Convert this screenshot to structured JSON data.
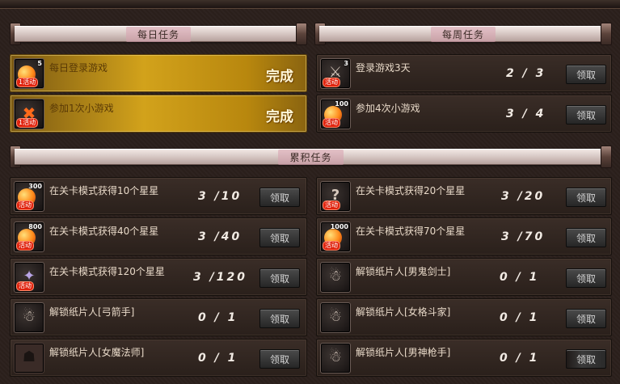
{
  "sections": {
    "daily": {
      "title": "每日任务"
    },
    "weekly": {
      "title": "每周任务"
    },
    "cumulative": {
      "title": "累积任务"
    }
  },
  "daily_tasks": [
    {
      "label": "每日登录游戏",
      "icon_num": "5",
      "icon_tag": "1活动",
      "status": "完成",
      "icon": "gift-orb-icon"
    },
    {
      "label": "参加1次小游戏",
      "icon_num": "",
      "icon_tag": "1活动",
      "status": "完成",
      "icon": "gift-cross-icon"
    }
  ],
  "weekly_tasks": [
    {
      "label": "登录游戏3天",
      "icon_num": "3",
      "icon_tag": "活动",
      "progress": "2 / 3",
      "button": "领取",
      "icon": "sword-icon"
    },
    {
      "label": "参加4次小游戏",
      "icon_num": "100",
      "icon_tag": "活动",
      "progress": "3 / 4",
      "button": "领取",
      "icon": "gift-orb-icon"
    }
  ],
  "cumulative_tasks": [
    {
      "label": "在关卡模式获得10个星星",
      "icon_num": "300",
      "icon_tag": "活动",
      "progress": "3 /10",
      "button": "领取",
      "icon": "gift-orb-icon"
    },
    {
      "label": "在关卡模式获得20个星星",
      "icon_num": "",
      "icon_tag": "活动",
      "progress": "3 /20",
      "button": "领取",
      "icon": "question-icon"
    },
    {
      "label": "在关卡模式获得40个星星",
      "icon_num": "800",
      "icon_tag": "活动",
      "progress": "3 /40",
      "button": "领取",
      "icon": "gift-orb-icon"
    },
    {
      "label": "在关卡模式获得70个星星",
      "icon_num": "1000",
      "icon_tag": "活动",
      "progress": "3 /70",
      "button": "领取",
      "icon": "gift-orb-icon"
    },
    {
      "label": "在关卡模式获得120个星星",
      "icon_num": "",
      "icon_tag": "活动",
      "progress": "3 /120",
      "button": "领取",
      "icon": "character-icon"
    },
    {
      "label": "解锁纸片人[男鬼剑士]",
      "icon_num": "",
      "icon_tag": "",
      "progress": "0 / 1",
      "button": "领取",
      "icon": "paper-figure-icon"
    },
    {
      "label": "解锁纸片人[弓箭手]",
      "icon_num": "",
      "icon_tag": "",
      "progress": "0 / 1",
      "button": "领取",
      "icon": "paper-figure-icon"
    },
    {
      "label": "解锁纸片人[女格斗家]",
      "icon_num": "",
      "icon_tag": "",
      "progress": "0 / 1",
      "button": "领取",
      "icon": "paper-figure-icon"
    },
    {
      "label": "解锁纸片人[女魔法师]",
      "icon_num": "",
      "icon_tag": "",
      "progress": "0 / 1",
      "button": "领取",
      "icon": "paper-figure-icon"
    },
    {
      "label": "解锁纸片人[男神枪手]",
      "icon_num": "",
      "icon_tag": "",
      "progress": "0 / 1",
      "button": "领取",
      "icon": "paper-figure-icon"
    }
  ],
  "colors": {
    "accent_gold": "#d2a21b",
    "panel_dark": "#2b201c",
    "banner_light": "#e6dad6"
  }
}
